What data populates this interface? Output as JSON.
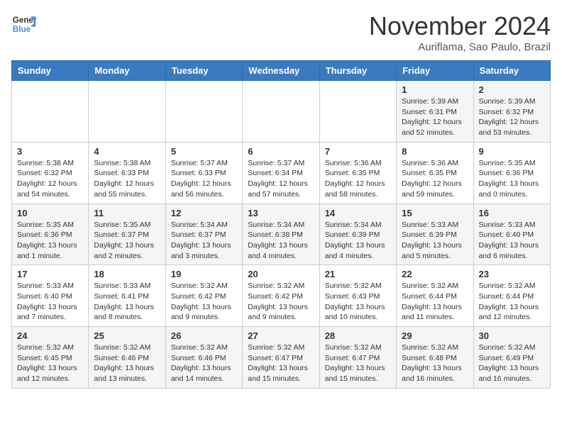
{
  "header": {
    "logo_line1": "General",
    "logo_line2": "Blue",
    "month_title": "November 2024",
    "location": "Auriflama, Sao Paulo, Brazil"
  },
  "weekdays": [
    "Sunday",
    "Monday",
    "Tuesday",
    "Wednesday",
    "Thursday",
    "Friday",
    "Saturday"
  ],
  "weeks": [
    [
      {
        "day": "",
        "info": ""
      },
      {
        "day": "",
        "info": ""
      },
      {
        "day": "",
        "info": ""
      },
      {
        "day": "",
        "info": ""
      },
      {
        "day": "",
        "info": ""
      },
      {
        "day": "1",
        "info": "Sunrise: 5:39 AM\nSunset: 6:31 PM\nDaylight: 12 hours\nand 52 minutes."
      },
      {
        "day": "2",
        "info": "Sunrise: 5:39 AM\nSunset: 6:32 PM\nDaylight: 12 hours\nand 53 minutes."
      }
    ],
    [
      {
        "day": "3",
        "info": "Sunrise: 5:38 AM\nSunset: 6:32 PM\nDaylight: 12 hours\nand 54 minutes."
      },
      {
        "day": "4",
        "info": "Sunrise: 5:38 AM\nSunset: 6:33 PM\nDaylight: 12 hours\nand 55 minutes."
      },
      {
        "day": "5",
        "info": "Sunrise: 5:37 AM\nSunset: 6:33 PM\nDaylight: 12 hours\nand 56 minutes."
      },
      {
        "day": "6",
        "info": "Sunrise: 5:37 AM\nSunset: 6:34 PM\nDaylight: 12 hours\nand 57 minutes."
      },
      {
        "day": "7",
        "info": "Sunrise: 5:36 AM\nSunset: 6:35 PM\nDaylight: 12 hours\nand 58 minutes."
      },
      {
        "day": "8",
        "info": "Sunrise: 5:36 AM\nSunset: 6:35 PM\nDaylight: 12 hours\nand 59 minutes."
      },
      {
        "day": "9",
        "info": "Sunrise: 5:35 AM\nSunset: 6:36 PM\nDaylight: 13 hours\nand 0 minutes."
      }
    ],
    [
      {
        "day": "10",
        "info": "Sunrise: 5:35 AM\nSunset: 6:36 PM\nDaylight: 13 hours\nand 1 minute."
      },
      {
        "day": "11",
        "info": "Sunrise: 5:35 AM\nSunset: 6:37 PM\nDaylight: 13 hours\nand 2 minutes."
      },
      {
        "day": "12",
        "info": "Sunrise: 5:34 AM\nSunset: 6:37 PM\nDaylight: 13 hours\nand 3 minutes."
      },
      {
        "day": "13",
        "info": "Sunrise: 5:34 AM\nSunset: 6:38 PM\nDaylight: 13 hours\nand 4 minutes."
      },
      {
        "day": "14",
        "info": "Sunrise: 5:34 AM\nSunset: 6:39 PM\nDaylight: 13 hours\nand 4 minutes."
      },
      {
        "day": "15",
        "info": "Sunrise: 5:33 AM\nSunset: 6:39 PM\nDaylight: 13 hours\nand 5 minutes."
      },
      {
        "day": "16",
        "info": "Sunrise: 5:33 AM\nSunset: 6:40 PM\nDaylight: 13 hours\nand 6 minutes."
      }
    ],
    [
      {
        "day": "17",
        "info": "Sunrise: 5:33 AM\nSunset: 6:40 PM\nDaylight: 13 hours\nand 7 minutes."
      },
      {
        "day": "18",
        "info": "Sunrise: 5:33 AM\nSunset: 6:41 PM\nDaylight: 13 hours\nand 8 minutes."
      },
      {
        "day": "19",
        "info": "Sunrise: 5:32 AM\nSunset: 6:42 PM\nDaylight: 13 hours\nand 9 minutes."
      },
      {
        "day": "20",
        "info": "Sunrise: 5:32 AM\nSunset: 6:42 PM\nDaylight: 13 hours\nand 9 minutes."
      },
      {
        "day": "21",
        "info": "Sunrise: 5:32 AM\nSunset: 6:43 PM\nDaylight: 13 hours\nand 10 minutes."
      },
      {
        "day": "22",
        "info": "Sunrise: 5:32 AM\nSunset: 6:44 PM\nDaylight: 13 hours\nand 11 minutes."
      },
      {
        "day": "23",
        "info": "Sunrise: 5:32 AM\nSunset: 6:44 PM\nDaylight: 13 hours\nand 12 minutes."
      }
    ],
    [
      {
        "day": "24",
        "info": "Sunrise: 5:32 AM\nSunset: 6:45 PM\nDaylight: 13 hours\nand 12 minutes."
      },
      {
        "day": "25",
        "info": "Sunrise: 5:32 AM\nSunset: 6:46 PM\nDaylight: 13 hours\nand 13 minutes."
      },
      {
        "day": "26",
        "info": "Sunrise: 5:32 AM\nSunset: 6:46 PM\nDaylight: 13 hours\nand 14 minutes."
      },
      {
        "day": "27",
        "info": "Sunrise: 5:32 AM\nSunset: 6:47 PM\nDaylight: 13 hours\nand 15 minutes."
      },
      {
        "day": "28",
        "info": "Sunrise: 5:32 AM\nSunset: 6:47 PM\nDaylight: 13 hours\nand 15 minutes."
      },
      {
        "day": "29",
        "info": "Sunrise: 5:32 AM\nSunset: 6:48 PM\nDaylight: 13 hours\nand 16 minutes."
      },
      {
        "day": "30",
        "info": "Sunrise: 5:32 AM\nSunset: 6:49 PM\nDaylight: 13 hours\nand 16 minutes."
      }
    ]
  ]
}
